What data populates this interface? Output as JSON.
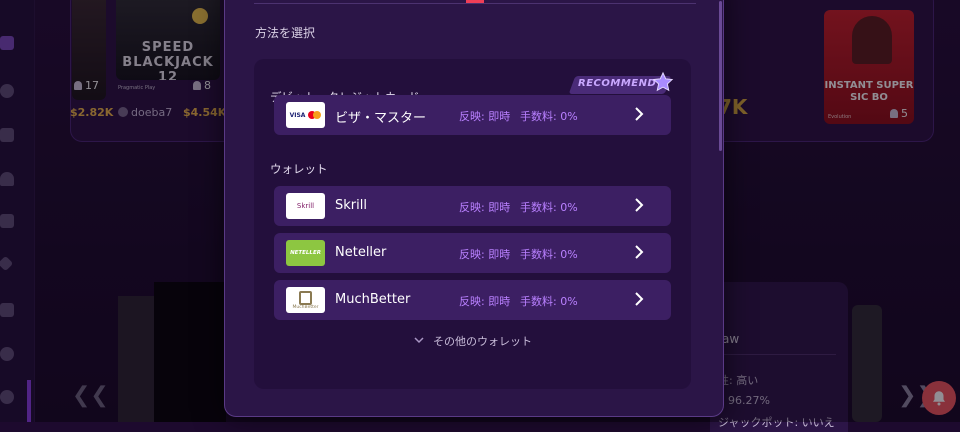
{
  "background": {
    "tiles": {
      "left_count": "17",
      "left_amount": "$2.82K",
      "blackjack_title_1": "SPEED",
      "blackjack_title_2": "BLACKJACK 12",
      "blackjack_provider": "Pragmatic Play",
      "blackjack_count": "8",
      "username": "doeba7",
      "blackjack_amount": "$4.54K",
      "big_amount": "7K",
      "sicbo_title_1": "INSTANT SUPER",
      "sicbo_title_2": "SIC BO",
      "sicbo_provider": "Evolution",
      "sicbo_count": "5"
    },
    "info_panel": {
      "heading": "aw",
      "line1": "性: 高い",
      "line2": "96.27%",
      "line3": "ジャックポット: いいえ"
    }
  },
  "modal": {
    "section_title": "方法を選択",
    "categories": {
      "card": "デビット・クレジットカード",
      "wallet": "ウォレット"
    },
    "recommend_label": "RECOMMEND",
    "methods": [
      {
        "name": "ビザ・マスター",
        "reflect": "反映: 即時",
        "fee": "手数料: 0%",
        "logo": "visa-mastercard"
      },
      {
        "name": "Skrill",
        "reflect": "反映: 即時",
        "fee": "手数料: 0%",
        "logo": "skrill"
      },
      {
        "name": "Neteller",
        "reflect": "反映: 即時",
        "fee": "手数料: 0%",
        "logo": "neteller"
      },
      {
        "name": "MuchBetter",
        "reflect": "反映: 即時",
        "fee": "手数料: 0%",
        "logo": "muchbetter"
      }
    ],
    "logo_text": {
      "visa": "VISA",
      "skrill": "Skrill",
      "neteller": "NETELLER",
      "muchbetter": "MuchBetter"
    },
    "more_wallets": "その他のウォレット"
  },
  "colors": {
    "accent_purple": "#b980ff",
    "row_bg": "#3c1f63",
    "modal_bg": "#2b1547",
    "bell_red": "#f0575e"
  }
}
